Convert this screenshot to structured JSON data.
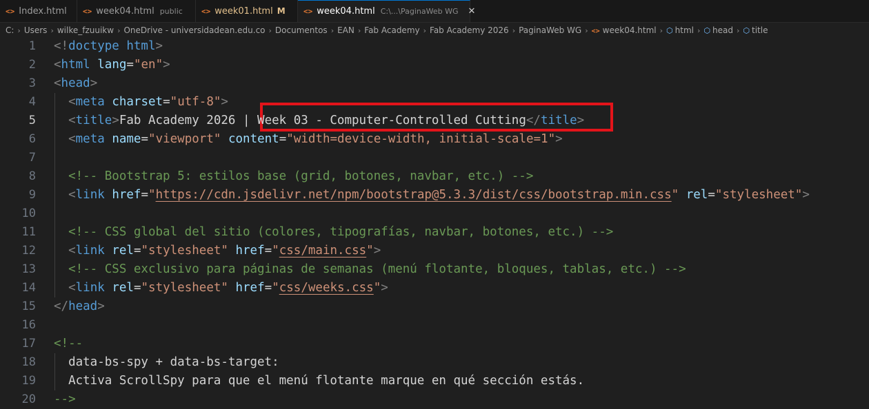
{
  "tabs": [
    {
      "name": "Index.html",
      "desc": "",
      "state": ""
    },
    {
      "name": "week04.html",
      "desc": "public",
      "state": ""
    },
    {
      "name": "week01.html",
      "desc": "",
      "state": "M"
    },
    {
      "name": "week04.html",
      "desc": "C:\\...\\PaginaWeb WG",
      "state": "active"
    }
  ],
  "tab_close_glyph": "✕",
  "breadcrumb": [
    "C:",
    "Users",
    "wilke_fzuuikw",
    "OneDrive - universidadean.edu.co",
    "Documentos",
    "EAN",
    "Fab Academy",
    "Fab Academy 2026",
    "PaginaWeb WG",
    "week04.html",
    "html",
    "head",
    "title"
  ],
  "icons": {
    "file": "html-file-icon",
    "symbol": "symbol-element-icon",
    "separator": "chevron-right-icon"
  },
  "colors": {
    "highlight_box": "#e3141a",
    "accent": "#0078d4"
  },
  "editor": {
    "current_line": 5,
    "lines": [
      {
        "n": "1",
        "t": "<!doctype html>"
      },
      {
        "n": "2",
        "t": "<html lang=\"en\">"
      },
      {
        "n": "3",
        "t": "<head>"
      },
      {
        "n": "4",
        "t": "  <meta charset=\"utf-8\">"
      },
      {
        "n": "5",
        "t": "  <title>Fab Academy 2026 | Week 03 - Computer-Controlled Cutting</title>"
      },
      {
        "n": "6",
        "t": "  <meta name=\"viewport\" content=\"width=device-width, initial-scale=1\">"
      },
      {
        "n": "7",
        "t": ""
      },
      {
        "n": "8",
        "t": "  <!-- Bootstrap 5: estilos base (grid, botones, navbar, etc.) -->"
      },
      {
        "n": "9",
        "t": "  <link href=\"https://cdn.jsdelivr.net/npm/bootstrap@5.3.3/dist/css/bootstrap.min.css\" rel=\"stylesheet\">"
      },
      {
        "n": "10",
        "t": ""
      },
      {
        "n": "11",
        "t": "  <!-- CSS global del sitio (colores, tipografías, navbar, botones, etc.) -->"
      },
      {
        "n": "12",
        "t": "  <link rel=\"stylesheet\" href=\"css/main.css\">"
      },
      {
        "n": "13",
        "t": "  <!-- CSS exclusivo para páginas de semanas (menú flotante, bloques, tablas, etc.) -->"
      },
      {
        "n": "14",
        "t": "  <link rel=\"stylesheet\" href=\"css/weeks.css\">"
      },
      {
        "n": "15",
        "t": "</head>"
      },
      {
        "n": "16",
        "t": ""
      },
      {
        "n": "17",
        "t": "<!--"
      },
      {
        "n": "18",
        "t": "  data-bs-spy + data-bs-target:"
      },
      {
        "n": "19",
        "t": "  Activa ScrollSpy para que el menú flotante marque en qué sección estás."
      },
      {
        "n": "20",
        "t": "-->"
      }
    ]
  }
}
